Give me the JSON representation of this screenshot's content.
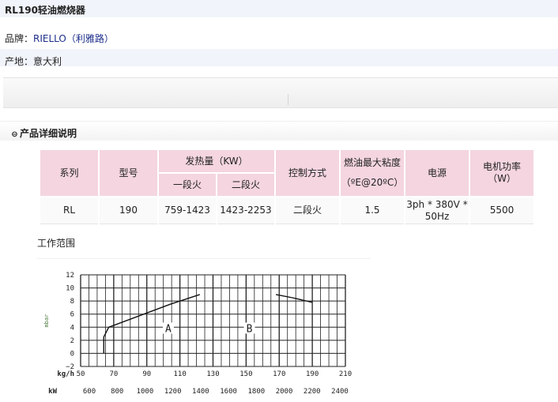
{
  "product": {
    "title": "RL190轻油燃烧器",
    "brand_label": "品牌：",
    "brand_value": "RIELLO（利雅路）",
    "origin_label": "产地：",
    "origin_value": "意大利"
  },
  "section": {
    "bullet_icon": "circle-minus-icon",
    "title": "产品详细说明"
  },
  "spec_table": {
    "headers": {
      "series": "系列",
      "model": "型号",
      "heat": "发热量（KW）",
      "stage1": "一段火",
      "stage2": "二段火",
      "control": "控制方式",
      "viscosity_1": "燃油最大粘度",
      "viscosity_2": "（ºE@20ºC）",
      "power": "电源",
      "motor_1": "电机功率",
      "motor_2": "（W）"
    },
    "row": {
      "series": "RL",
      "model": "190",
      "stage1": "759-1423",
      "stage2": "1423-2253",
      "control": "二段火",
      "viscosity": "1.5",
      "power_1": "3ph * 380V *",
      "power_2": "50Hz",
      "motor": "5500"
    }
  },
  "working_range": {
    "label": "工作范围",
    "chart_data": {
      "type": "line",
      "title": "",
      "ylabel": "mbar",
      "xlabel_kgh": "kg/h",
      "xlabel_kw": "kW",
      "y_ticks": [
        "12",
        "10",
        "8",
        "6",
        "4",
        "2",
        "0",
        "−2"
      ],
      "kgh_ticks": [
        "50",
        "70",
        "90",
        "110",
        "130",
        "150",
        "170",
        "190",
        "210"
      ],
      "kw_ticks": [
        "600",
        "800",
        "1000",
        "1200",
        "1400",
        "1600",
        "1800",
        "2000",
        "2200",
        "2400"
      ],
      "ylim": [
        -2,
        12
      ],
      "xlim_kgh": [
        50,
        210
      ],
      "regions": [
        "A",
        "B"
      ],
      "series": [
        {
          "points": [
            [
              64,
              0
            ],
            [
              64,
              2.5
            ],
            [
              67,
              4
            ],
            [
              104,
              7.5
            ],
            [
              122,
              9
            ]
          ]
        },
        {
          "points": [
            [
              168,
              9
            ],
            [
              178,
              8.5
            ],
            [
              190,
              7.8
            ]
          ]
        }
      ],
      "region_positions": [
        [
          103,
          3.5
        ],
        [
          152,
          3.5
        ]
      ],
      "grid": true
    }
  }
}
